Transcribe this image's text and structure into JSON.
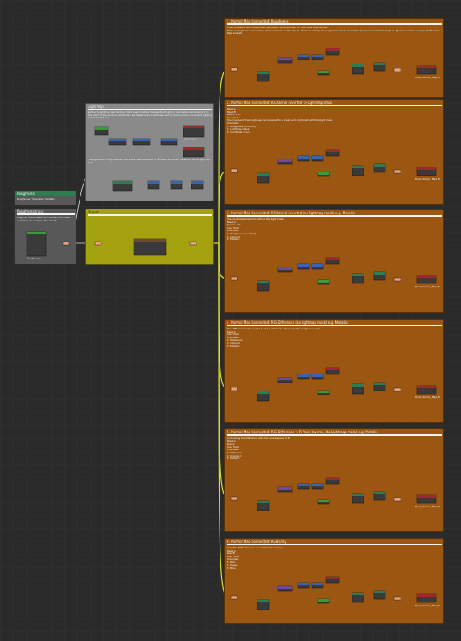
{
  "colors": {
    "canvas_bg": "#2a2a2a",
    "comment_orange": "#9b5711",
    "comment_grey": "#8a8a8a",
    "comment_olive": "#a4a20f",
    "wire_yellow": "#e0dc2c",
    "wire_white": "#dddddd",
    "node_teal": "#2e7d52",
    "node_blue": "#3a64b0",
    "node_green": "#3b9a3b",
    "node_red": "#9c2a2a",
    "node_purple": "#6e4a9a",
    "reroute_pink": "#e8a085"
  },
  "left_group": {
    "title": "Roughness",
    "subtitle": "Roughness / Specular / Metallic",
    "input_panel_title": "Roughness Input",
    "input_panel_desc": "Plug this to the Base and connect it to the 6 variations to compare the results."
  },
  "light_map_panel": {
    "title": "Light Map",
    "desc": "Notice: A lightmap is a texture that's used to store the results of lighting calculations and apply it to the mesh of the surface. Lightmaps are baked using Lightmass and contain indirect (bounced) lighting and soft shadows.",
    "note": "The lightmap is only visible if the scene was rendered to include the current level and all its lightmap data.",
    "node_label": "Light Map"
  },
  "olive_panel": {
    "title": "Output"
  },
  "comparison_panels": [
    {
      "title": "1. Normal Map Connected: Roughness",
      "desc": "Now try testing with Roughness, as output. A comparison for the three approaches.\nMake a Roughness connection, the 4 channels on the inputs. It should always be plugged as the 1 channel to the nearest mask lines (R, G, B) which will be used by the Normal Map Sockets.",
      "final_label": "Final_Normal_Map_B"
    },
    {
      "title": "2. Normal Map Connected: R-Channel inverted -> Lightmap mask",
      "desc": "Mask A\nMask B\nPass C + D\nUse Tile A\nThe inverse of the roughness is converted to a mask and combined with the light mask.\nChannels:\nR: Roughness (inverted)\nG: Lightmap mask\nB: Combined result",
      "final_label": "Final_Normal_Map_B"
    },
    {
      "title": "3. Normal Map Connected: R-Channel inverted (no lightmap mask) e.g. Metallic",
      "desc": "The roughness inverted without the light mask.\nMask A\nPass C + D\nUse Tile A\nChannels:\nR: Roughness (inverted)\nG: Unused\nB: Metallic",
      "final_label": "Final_Normal_Map_B"
    },
    {
      "title": "4. Normal Map Connected: R-G-Difference (no lightmap mask) e.g. Metallic",
      "desc": "The difference between the R and G channels, driven by the roughness value.\nMask A\nUse Tile A\nChannels:\nR: Difference\nG: Unused\nB: Metallic",
      "final_label": "Final_Normal_Map_B"
    },
    {
      "title": "5. Normal Map Connected: R-G-Difference + R-Pass (Inverse, No Lightmap mask) e.g. Metallic",
      "desc": "Combining the difference with the inverse pass of R.\nMask A\nPass C\nUse Tile A\nChannels:\nR: Difference\nG: Inverse R\nB: Metallic",
      "final_label": "Final_Normal_Map_B"
    },
    {
      "title": "6. Normal Map Connected: RGB Only",
      "desc": "Only the RGB channels, no additional masking.\nMask A\nPass B\nUse Tile A\nChannels:\nR: Red\nG: Green\nB: Blue",
      "final_label": "Final_Normal_Map_B"
    }
  ],
  "node_labels": {
    "input": "Roughness",
    "lerp": "Lerp",
    "mask": "Mask",
    "multiply": "Multiply",
    "one_minus": "OneMinus",
    "light_map": "Light Map",
    "texture": "Texture Sample",
    "append": "Append"
  }
}
